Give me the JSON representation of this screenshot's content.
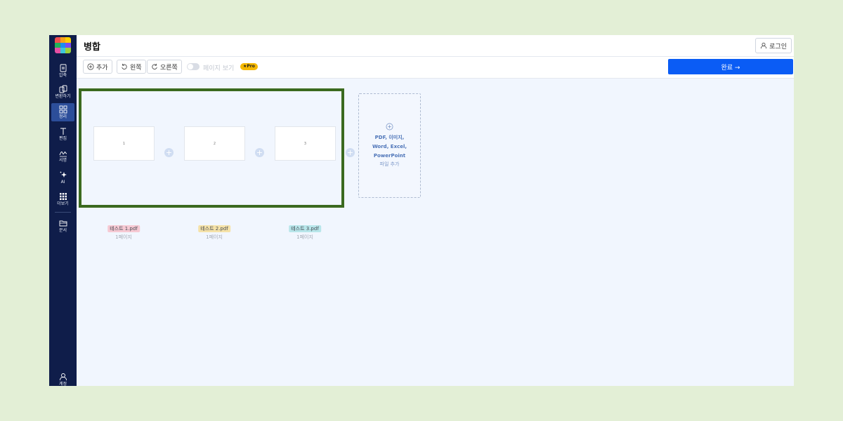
{
  "sidebar": {
    "items": [
      {
        "label": "압축",
        "icon": "compress-icon",
        "active": false
      },
      {
        "label": "변환하기",
        "icon": "convert-icon",
        "active": false
      },
      {
        "label": "정리",
        "icon": "organize-icon",
        "active": true
      },
      {
        "label": "편집",
        "icon": "edit-text-icon",
        "active": false
      },
      {
        "label": "서명",
        "icon": "signature-icon",
        "active": false
      },
      {
        "label": "AI",
        "icon": "ai-sparkle-icon",
        "active": false
      },
      {
        "label": "더보기",
        "icon": "more-grid-icon",
        "active": false
      },
      {
        "label": "문서",
        "icon": "documents-icon",
        "active": false
      }
    ],
    "account_label": "계정"
  },
  "header": {
    "title": "병합",
    "login_label": "로그인"
  },
  "toolbar": {
    "add_label": "추가",
    "rotate_left_label": "왼쪽",
    "rotate_right_label": "오른쪽",
    "page_view_label": "페이지 보기",
    "pro_badge": "★Pro",
    "done_label": "완료 →"
  },
  "files": [
    {
      "page_number": "1",
      "name": "테스트 1.pdf",
      "pages": "1페이지",
      "tag_color": "#f6c9d3"
    },
    {
      "page_number": "2",
      "name": "테스트 2.pdf",
      "pages": "1페이지",
      "tag_color": "#f5e2a8"
    },
    {
      "page_number": "3",
      "name": "테스트 3.pdf",
      "pages": "1페이지",
      "tag_color": "#b8e6ea"
    }
  ],
  "add_file": {
    "types_line1": "PDF, 이미지,",
    "types_line2": "Word, Excel,",
    "types_line3": "PowerPoint",
    "label": "파일 추가"
  },
  "colors": {
    "sidebar_bg": "#0f1d4a",
    "accent": "#0a5cf5",
    "highlight_border": "#3b6a1f"
  }
}
